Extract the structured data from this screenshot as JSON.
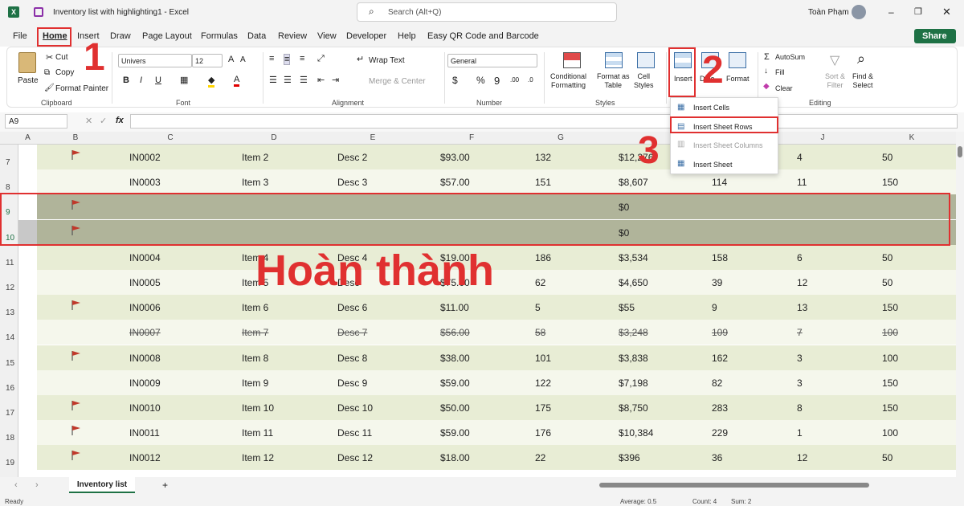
{
  "titlebar": {
    "file_name": "Inventory list with highlighting1",
    "app": "Excel",
    "search_placeholder": "Search (Alt+Q)",
    "user": "Toàn Phạm"
  },
  "menu": {
    "file": "File",
    "home": "Home",
    "insert": "Insert",
    "draw": "Draw",
    "page_layout": "Page Layout",
    "formulas": "Formulas",
    "data": "Data",
    "review": "Review",
    "view": "View",
    "developer": "Developer",
    "help": "Help",
    "qr": "Easy QR Code and Barcode",
    "share": "Share"
  },
  "ribbon": {
    "paste": "Paste",
    "cut": "Cut",
    "copy": "Copy",
    "format_painter": "Format Painter",
    "clipboard": "Clipboard",
    "font_name": "Univers",
    "font_size": "12",
    "font": "Font",
    "wrap_text": "Wrap Text",
    "merge_center": "Merge & Center",
    "alignment": "Alignment",
    "number_format": "General",
    "number": "Number",
    "cond_format": "Conditional Formatting",
    "cond_format_1": "Conditional",
    "cond_format_2": "Formatting",
    "format_table_1": "Format as",
    "format_table_2": "Table",
    "cell_styles_1": "Cell",
    "cell_styles_2": "Styles",
    "styles": "Styles",
    "insert": "Insert",
    "delete": "Dele",
    "format": "Format",
    "autosum": "AutoSum",
    "fill": "Fill",
    "clear": "Clear",
    "sort_1": "Sort &",
    "sort_2": "Filter",
    "find_1": "Find &",
    "find_2": "Select",
    "editing": "Editing"
  },
  "formula": {
    "name_box": "A9",
    "fx": "fx"
  },
  "columns": [
    "A",
    "B",
    "C",
    "D",
    "E",
    "F",
    "G",
    "",
    "I",
    "J",
    "K"
  ],
  "rows": [
    {
      "num": "7",
      "flag": true,
      "id": "IN0002",
      "item": "Item 2",
      "desc": "Desc 2",
      "price": "$93.00",
      "qty": "132",
      "total": "$12,276",
      "i": "",
      "j": "4",
      "k": "50"
    },
    {
      "num": "8",
      "flag": false,
      "id": "IN0003",
      "item": "Item 3",
      "desc": "Desc 3",
      "price": "$57.00",
      "qty": "151",
      "total": "$8,607",
      "i": "114",
      "j": "11",
      "k": "150"
    },
    {
      "num": "9",
      "flag": true,
      "id": "",
      "item": "",
      "desc": "",
      "price": "",
      "qty": "",
      "total": "$0",
      "i": "",
      "j": "",
      "k": ""
    },
    {
      "num": "10",
      "flag": true,
      "id": "",
      "item": "",
      "desc": "",
      "price": "",
      "qty": "",
      "total": "$0",
      "i": "",
      "j": "",
      "k": ""
    },
    {
      "num": "11",
      "flag": false,
      "id": "IN0004",
      "item": "Item 4",
      "desc": "Desc 4",
      "price": "$19.00",
      "qty": "186",
      "total": "$3,534",
      "i": "158",
      "j": "6",
      "k": "50"
    },
    {
      "num": "12",
      "flag": false,
      "id": "IN0005",
      "item": "Item 5",
      "desc": "Desc",
      "price": "$75.00",
      "qty": "62",
      "total": "$4,650",
      "i": "39",
      "j": "12",
      "k": "50"
    },
    {
      "num": "13",
      "flag": true,
      "id": "IN0006",
      "item": "Item 6",
      "desc": "Desc 6",
      "price": "$11.00",
      "qty": "5",
      "total": "$55",
      "i": "9",
      "j": "13",
      "k": "150"
    },
    {
      "num": "14",
      "flag": false,
      "id": "IN0007",
      "item": "Item 7",
      "desc": "Desc 7",
      "price": "$56.00",
      "qty": "58",
      "total": "$3,248",
      "i": "109",
      "j": "7",
      "k": "100"
    },
    {
      "num": "15",
      "flag": true,
      "id": "IN0008",
      "item": "Item 8",
      "desc": "Desc 8",
      "price": "$38.00",
      "qty": "101",
      "total": "$3,838",
      "i": "162",
      "j": "3",
      "k": "100"
    },
    {
      "num": "16",
      "flag": false,
      "id": "IN0009",
      "item": "Item 9",
      "desc": "Desc 9",
      "price": "$59.00",
      "qty": "122",
      "total": "$7,198",
      "i": "82",
      "j": "3",
      "k": "150"
    },
    {
      "num": "17",
      "flag": true,
      "id": "IN0010",
      "item": "Item 10",
      "desc": "Desc 10",
      "price": "$50.00",
      "qty": "175",
      "total": "$8,750",
      "i": "283",
      "j": "8",
      "k": "150"
    },
    {
      "num": "18",
      "flag": true,
      "id": "IN0011",
      "item": "Item 11",
      "desc": "Desc 11",
      "price": "$59.00",
      "qty": "176",
      "total": "$10,384",
      "i": "229",
      "j": "1",
      "k": "100"
    },
    {
      "num": "19",
      "flag": true,
      "id": "IN0012",
      "item": "Item 12",
      "desc": "Desc 12",
      "price": "$18.00",
      "qty": "22",
      "total": "$396",
      "i": "36",
      "j": "12",
      "k": "50"
    }
  ],
  "dropdown": {
    "cells": "Insert Cells",
    "rows": "Insert Sheet Rows",
    "columns": "Insert Sheet Columns",
    "sheet": "Insert Sheet"
  },
  "annotations": {
    "step1": "1",
    "step2": "2",
    "step3": "3",
    "done": "Hoàn thành"
  },
  "sheet": {
    "tab": "Inventory list",
    "add": "+"
  },
  "status": {
    "ready": "Ready",
    "average": "Average: 0.5",
    "count": "Count: 4",
    "sum": "Sum: 2"
  },
  "colors": {
    "band_green": "#e8edd5",
    "band_light": "#f5f7ec",
    "selected": "#b0b49a",
    "annotation": "#e03030",
    "excel_green": "#1e7145"
  }
}
